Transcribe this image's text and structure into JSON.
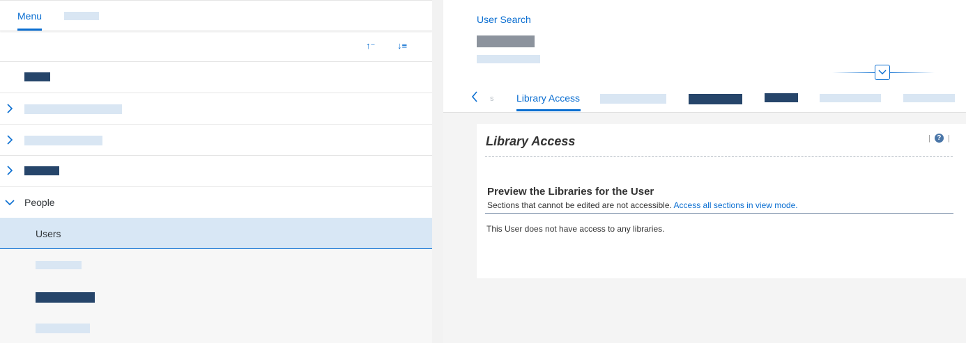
{
  "menu_panel": {
    "tabs": [
      {
        "label": "Menu",
        "active": true
      }
    ],
    "toolbar": {
      "sort_ascending_icon": "sort-ascending-icon",
      "sort_descending_icon": "sort-descending-icon"
    },
    "tree": {
      "people": {
        "label": "People",
        "expanded": true
      },
      "users": {
        "label": "Users",
        "selected": true
      }
    }
  },
  "detail_panel": {
    "breadcrumb": "User Search",
    "tabs": [
      {
        "label": "Library Access",
        "active": true
      }
    ],
    "section": {
      "title": "Library Access",
      "preview_title": "Preview the Libraries for the User",
      "preview_desc": "Sections that cannot be edited are not accessible.",
      "preview_link": "Access all sections in view mode.",
      "empty_message": "This User does not have access to any libraries.",
      "help_icon": "?"
    }
  },
  "colors": {
    "accent": "#0a6ed1",
    "selected_row": "#d8e7f5",
    "redacted_dark": "#26456a",
    "redacted_light": "#d9e6f3"
  }
}
